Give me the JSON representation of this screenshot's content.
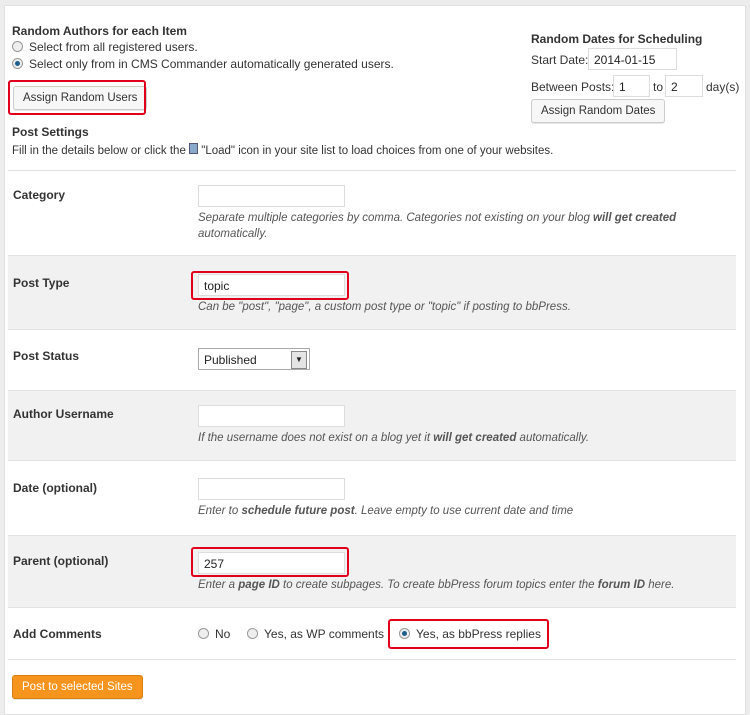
{
  "authors": {
    "title": "Random Authors for each Item",
    "option_all": "Select from all registered users.",
    "option_generated": "Select only from in CMS Commander automatically generated users.",
    "selected": "generated",
    "assign_button": "Assign Random Users"
  },
  "dates": {
    "title": "Random Dates for Scheduling",
    "start_label": "Start Date:",
    "start_value": "2014-01-15",
    "between_label": "Between Posts:",
    "from_value": "1",
    "to_label": "to",
    "to_value": "2",
    "unit": "day(s)",
    "assign_button": "Assign Random Dates"
  },
  "post_settings": {
    "title": "Post Settings",
    "intro_before": "Fill in the details below or click the",
    "intro_after": "\"Load\" icon in your site list to load choices from one of your websites."
  },
  "fields": {
    "category": {
      "label": "Category",
      "value": "",
      "desc_1": "Separate multiple categories by comma. Categories not existing on your blog ",
      "desc_bold": "will get created",
      "desc_2": " automatically."
    },
    "post_type": {
      "label": "Post Type",
      "value": "topic",
      "desc": "Can be \"post\", \"page\", a custom post type or \"topic\" if posting to bbPress."
    },
    "post_status": {
      "label": "Post Status",
      "value": "Published"
    },
    "author": {
      "label": "Author Username",
      "value": "",
      "desc_1": "If the username does not exist on a blog yet it ",
      "desc_bold": "will get created",
      "desc_2": " automatically."
    },
    "date": {
      "label": "Date (optional)",
      "value": "",
      "desc_1": "Enter to ",
      "desc_bold": "schedule future post",
      "desc_2": ". Leave empty to use current date and time"
    },
    "parent": {
      "label": "Parent (optional)",
      "value": "257",
      "desc_1": "Enter a ",
      "desc_bold1": "page ID",
      "desc_2": " to create subpages. To create bbPress forum topics enter the ",
      "desc_bold2": "forum ID",
      "desc_3": " here."
    },
    "comments": {
      "label": "Add Comments",
      "options": [
        "No",
        "Yes, as WP comments",
        "Yes, as bbPress replies"
      ],
      "selected": "Yes, as bbPress replies"
    }
  },
  "submit_button": "Post to selected Sites",
  "colors": {
    "highlight": "#e0001b",
    "primary_button": "#f7941d"
  }
}
